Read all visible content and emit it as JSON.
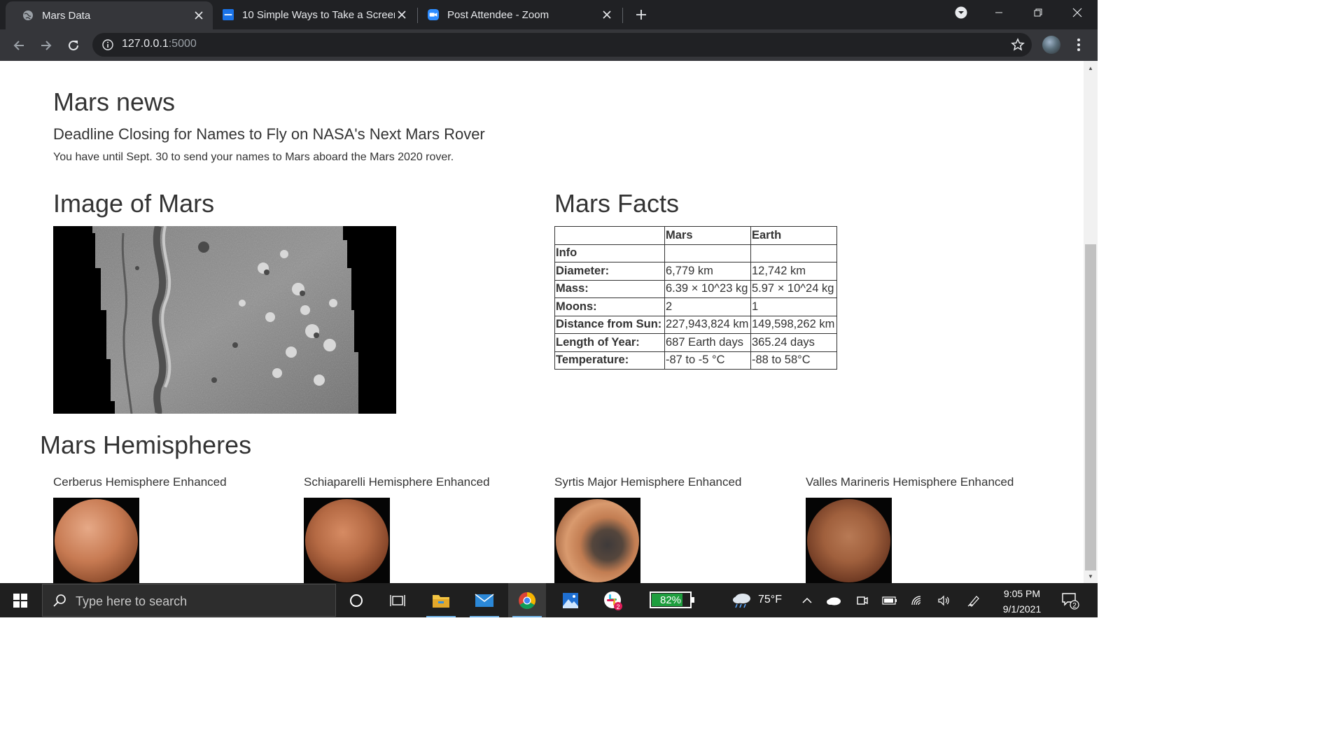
{
  "browser": {
    "tabs": [
      {
        "title": "Mars Data",
        "active": true,
        "icon": "globe-icon"
      },
      {
        "title": "10 Simple Ways to Take a Screen",
        "active": false,
        "icon": "site-favicon"
      },
      {
        "title": "Post Attendee - Zoom",
        "active": false,
        "icon": "zoom-icon"
      }
    ],
    "url_host": "127.0.0.1",
    "url_port": ":5000"
  },
  "page": {
    "news_heading": "Mars news",
    "news_title": "Deadline Closing for Names to Fly on NASA's Next Mars Rover",
    "news_paragraph": "You have until Sept. 30 to send your names to Mars aboard the Mars 2020 rover.",
    "image_heading": "Image of Mars",
    "facts_heading": "Mars Facts",
    "facts_table": {
      "header": [
        "",
        "Mars",
        "Earth"
      ],
      "index_label": "Info",
      "rows": [
        [
          "Diameter:",
          "6,779 km",
          "12,742 km"
        ],
        [
          "Mass:",
          "6.39 × 10^23 kg",
          "5.97 × 10^24 kg"
        ],
        [
          "Moons:",
          "2",
          "1"
        ],
        [
          "Distance from Sun:",
          "227,943,824 km",
          "149,598,262 km"
        ],
        [
          "Length of Year:",
          "687 Earth days",
          "365.24 days"
        ],
        [
          "Temperature:",
          "-87 to -5 °C",
          "-88 to 58°C"
        ]
      ]
    },
    "hemispheres_heading": "Mars Hemispheres",
    "hemispheres": [
      {
        "title": "Cerberus Hemisphere Enhanced"
      },
      {
        "title": "Schiaparelli Hemisphere Enhanced"
      },
      {
        "title": "Syrtis Major Hemisphere Enhanced"
      },
      {
        "title": "Valles Marineris Hemisphere Enhanced"
      }
    ]
  },
  "taskbar": {
    "search_placeholder": "Type here to search",
    "battery_percent": "82%",
    "battery_level": 0.82,
    "weather_temp": "75°F",
    "time": "9:05 PM",
    "date": "9/1/2021",
    "notification_count": "2",
    "slack_badge": "2"
  }
}
